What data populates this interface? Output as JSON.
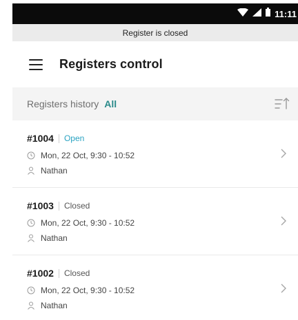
{
  "status_bar": {
    "time": "11:11",
    "icons": [
      "wifi-icon",
      "signal-icon",
      "battery-icon"
    ]
  },
  "banner": {
    "text": "Register is closed"
  },
  "header": {
    "menu_icon": "hamburger-menu-icon",
    "title": "Registers control"
  },
  "sub_header": {
    "title": "Registers history",
    "filter": "All",
    "sort_icon": "sort-icon"
  },
  "registers": [
    {
      "id": "#1004",
      "status": "Open",
      "time": "Mon, 22 Oct, 9:30 - 10:52",
      "user": "Nathan"
    },
    {
      "id": "#1003",
      "status": "Closed",
      "time": "Mon, 22 Oct, 9:30 - 10:52",
      "user": "Nathan"
    },
    {
      "id": "#1002",
      "status": "Closed",
      "time": "Mon, 22 Oct, 9:30 - 10:52",
      "user": "Nathan"
    }
  ],
  "colors": {
    "accent": "#2a8a8a",
    "open_status": "#2aa3c2",
    "status_bar": "#0b0b0b",
    "banner_bg": "#ebebeb",
    "subheader_bg": "#f4f4f4"
  }
}
